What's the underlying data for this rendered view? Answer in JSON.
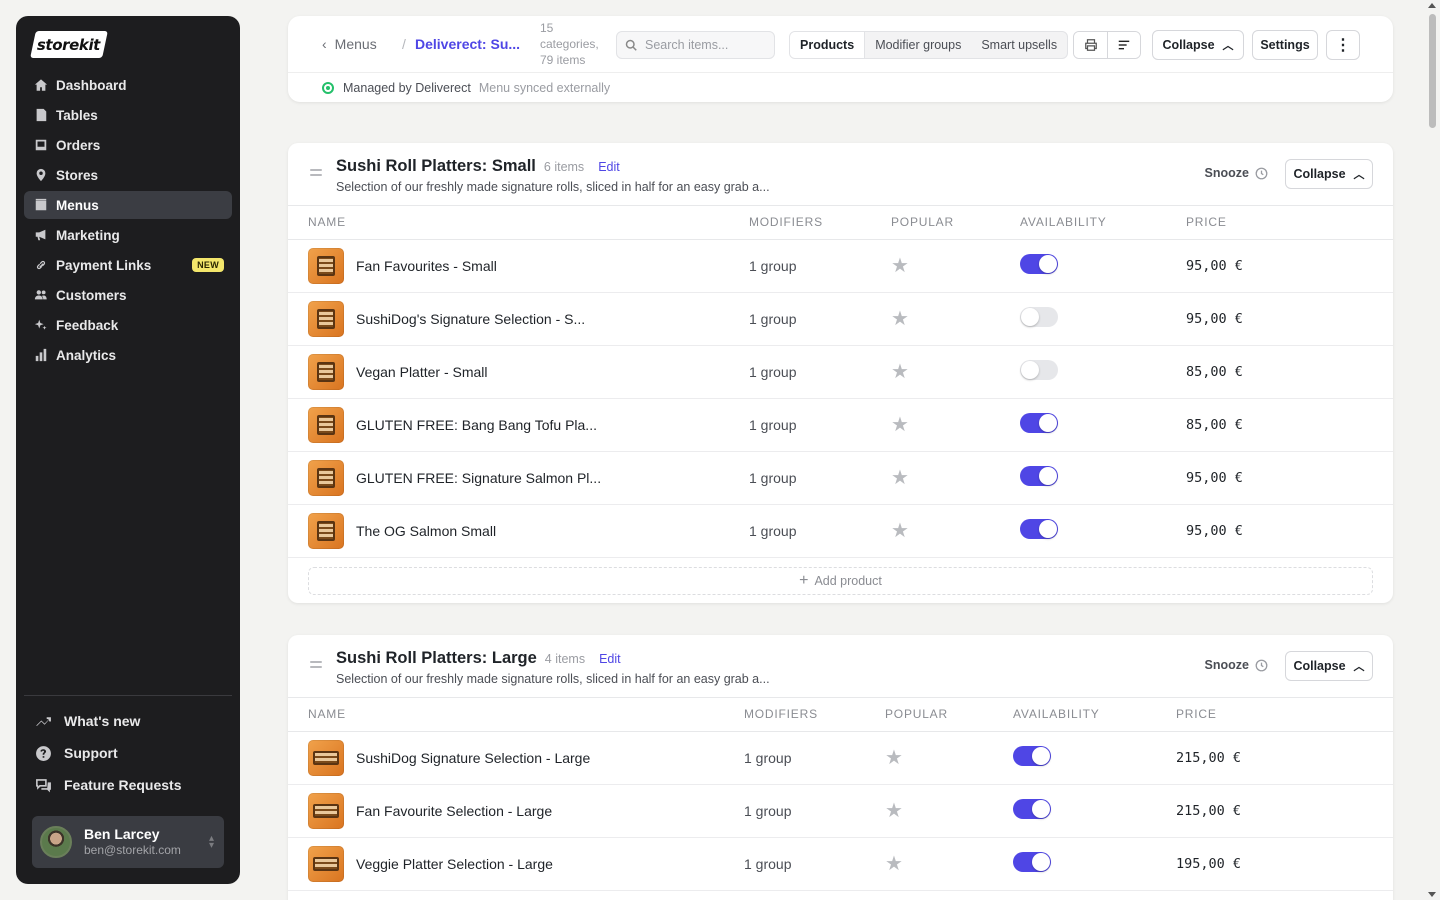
{
  "brand": {
    "logo_text": "storekit",
    "accent": "#4f46e5",
    "sidebar_bg": "#1d1d1f"
  },
  "sidebar": {
    "items": [
      {
        "label": "Dashboard",
        "icon": "home-icon"
      },
      {
        "label": "Tables",
        "icon": "table-icon"
      },
      {
        "label": "Orders",
        "icon": "orders-icon"
      },
      {
        "label": "Stores",
        "icon": "map-pin-icon"
      },
      {
        "label": "Menus",
        "icon": "menu-icon",
        "active": true
      },
      {
        "label": "Marketing",
        "icon": "megaphone-icon"
      },
      {
        "label": "Payment Links",
        "icon": "link-icon",
        "badge": "NEW"
      },
      {
        "label": "Customers",
        "icon": "users-icon"
      },
      {
        "label": "Feedback",
        "icon": "sparkle-icon"
      },
      {
        "label": "Analytics",
        "icon": "bar-chart-icon"
      }
    ],
    "bottom": [
      {
        "label": "What's new",
        "icon": "trend-up-icon"
      },
      {
        "label": "Support",
        "icon": "help-icon"
      },
      {
        "label": "Feature Requests",
        "icon": "chat-icon"
      }
    ],
    "user": {
      "name": "Ben Larcey",
      "email": "ben@storekit.com"
    }
  },
  "header": {
    "back_label": "Menus",
    "menu_title": "Deliverect: Su...",
    "meta": "15 categories, 79 items",
    "search_placeholder": "Search items...",
    "tabs": [
      "Products",
      "Modifier groups",
      "Smart upsells"
    ],
    "active_tab": "Products",
    "collapse_label": "Collapse",
    "settings_label": "Settings",
    "managed_label": "Managed by Deliverect",
    "synced_label": "Menu synced externally"
  },
  "columns": [
    "NAME",
    "MODIFIERS",
    "POPULAR",
    "AVAILABILITY",
    "PRICE"
  ],
  "categories": [
    {
      "title": "Sushi Roll Platters: Small",
      "count": "6 items",
      "edit_label": "Edit",
      "description": "Selection of our freshly made signature rolls, sliced in half for an easy grab a...",
      "snooze_label": "Snooze",
      "collapse_label": "Collapse",
      "add_label": "Add product",
      "products": [
        {
          "name": "Fan Favourites - Small",
          "modifiers": "1 group",
          "available": true,
          "price": "95,00 €"
        },
        {
          "name": "SushiDog's Signature Selection - S...",
          "modifiers": "1 group",
          "available": false,
          "price": "95,00 €"
        },
        {
          "name": "Vegan Platter - Small",
          "modifiers": "1 group",
          "available": false,
          "price": "85,00 €"
        },
        {
          "name": "GLUTEN FREE: Bang Bang Tofu Pla...",
          "modifiers": "1 group",
          "available": true,
          "price": "85,00 €"
        },
        {
          "name": "GLUTEN FREE: Signature Salmon Pl...",
          "modifiers": "1 group",
          "available": true,
          "price": "95,00 €"
        },
        {
          "name": "The OG Salmon Small",
          "modifiers": "1 group",
          "available": true,
          "price": "95,00 €"
        }
      ]
    },
    {
      "title": "Sushi Roll Platters: Large",
      "count": "4 items",
      "edit_label": "Edit",
      "description": "Selection of our freshly made signature rolls, sliced in half for an easy grab a...",
      "snooze_label": "Snooze",
      "collapse_label": "Collapse",
      "products": [
        {
          "name": "SushiDog Signature Selection - Large",
          "modifiers": "1 group",
          "available": true,
          "price": "215,00 €"
        },
        {
          "name": "Fan Favourite Selection - Large",
          "modifiers": "1 group",
          "available": true,
          "price": "215,00 €"
        },
        {
          "name": "Veggie Platter Selection - Large",
          "modifiers": "1 group",
          "available": true,
          "price": "195,00 €"
        }
      ]
    }
  ]
}
